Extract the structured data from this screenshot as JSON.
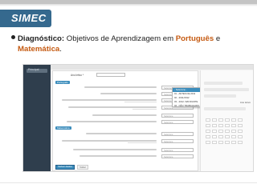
{
  "slide": {
    "title": "SIMEC",
    "bullet": {
      "part1": "Diagnóstico:",
      "part2": " Objetivos de Aprendizagem em ",
      "part3": "Português",
      "part4": " e ",
      "part5": "Matemática",
      "part6": "."
    }
  },
  "screen": {
    "sidebar_label": "Principal",
    "anoletivo_label": "Ano letivo *",
    "sections": [
      "Português",
      "Matemática"
    ],
    "select_placeholder": "Selecione",
    "dropdown_options": [
      "- Selecione -",
      "01 - ANTES DE 2011",
      "02 - 2011/2012",
      "03 - 2012 / EM DIANTE",
      "04 - NÃO TRABALHADO"
    ],
    "save_label": "Salvar dados",
    "back_label": "Voltar",
    "right_label": "Ano letivo"
  },
  "colors": {
    "title_bar": "#35698e",
    "accent_text": "#c55a11",
    "app_blue": "#3c8dbc",
    "app_sidebar": "#2f3e4d"
  }
}
